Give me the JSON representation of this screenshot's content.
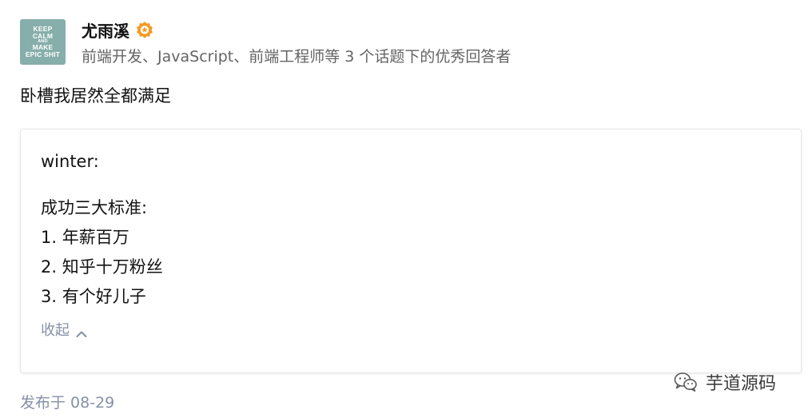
{
  "author": {
    "avatar_lines": [
      "KEEP",
      "CALM",
      "AND",
      "MAKE",
      "EPIC SHIT"
    ],
    "name": "尤雨溪",
    "headline": "前端开发、JavaScript、前端工程师等 3 个话题下的优秀回答者",
    "badge_icon": "verified-badge-icon",
    "badge_color": "#f59a23"
  },
  "answer": {
    "text": "卧槽我居然全都满足"
  },
  "quote": {
    "author": "winter:",
    "lines": [
      "成功三大标准:",
      "1. 年薪百万",
      "2. 知乎十万粉丝",
      "3. 有个好儿子"
    ],
    "collapse_label": "收起",
    "collapse_icon": "chevron-up-icon"
  },
  "footer": {
    "publish_time": "发布于 08-29"
  },
  "watermark": {
    "icon": "wechat-icon",
    "text": "芋道源码"
  },
  "colors": {
    "text_primary": "#121212",
    "text_secondary": "#646464",
    "text_muted": "#8590a6",
    "avatar_bg": "#86aeaa",
    "card_border": "#e6e6e6"
  }
}
